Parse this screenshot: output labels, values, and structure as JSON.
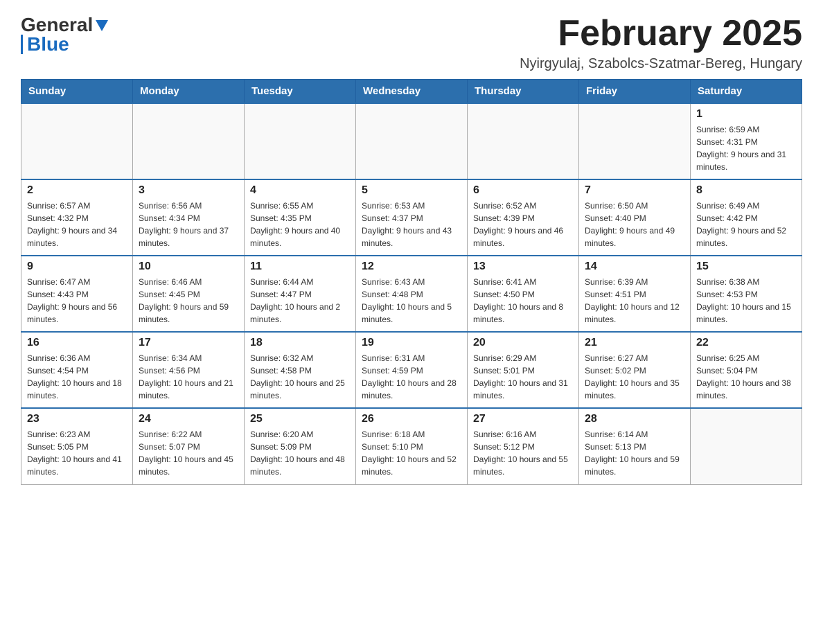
{
  "header": {
    "logo": {
      "general": "General",
      "blue": "Blue"
    },
    "title": "February 2025",
    "location": "Nyirgyulaj, Szabolcs-Szatmar-Bereg, Hungary"
  },
  "weekdays": [
    "Sunday",
    "Monday",
    "Tuesday",
    "Wednesday",
    "Thursday",
    "Friday",
    "Saturday"
  ],
  "weeks": [
    [
      {
        "day": "",
        "info": ""
      },
      {
        "day": "",
        "info": ""
      },
      {
        "day": "",
        "info": ""
      },
      {
        "day": "",
        "info": ""
      },
      {
        "day": "",
        "info": ""
      },
      {
        "day": "",
        "info": ""
      },
      {
        "day": "1",
        "info": "Sunrise: 6:59 AM\nSunset: 4:31 PM\nDaylight: 9 hours and 31 minutes."
      }
    ],
    [
      {
        "day": "2",
        "info": "Sunrise: 6:57 AM\nSunset: 4:32 PM\nDaylight: 9 hours and 34 minutes."
      },
      {
        "day": "3",
        "info": "Sunrise: 6:56 AM\nSunset: 4:34 PM\nDaylight: 9 hours and 37 minutes."
      },
      {
        "day": "4",
        "info": "Sunrise: 6:55 AM\nSunset: 4:35 PM\nDaylight: 9 hours and 40 minutes."
      },
      {
        "day": "5",
        "info": "Sunrise: 6:53 AM\nSunset: 4:37 PM\nDaylight: 9 hours and 43 minutes."
      },
      {
        "day": "6",
        "info": "Sunrise: 6:52 AM\nSunset: 4:39 PM\nDaylight: 9 hours and 46 minutes."
      },
      {
        "day": "7",
        "info": "Sunrise: 6:50 AM\nSunset: 4:40 PM\nDaylight: 9 hours and 49 minutes."
      },
      {
        "day": "8",
        "info": "Sunrise: 6:49 AM\nSunset: 4:42 PM\nDaylight: 9 hours and 52 minutes."
      }
    ],
    [
      {
        "day": "9",
        "info": "Sunrise: 6:47 AM\nSunset: 4:43 PM\nDaylight: 9 hours and 56 minutes."
      },
      {
        "day": "10",
        "info": "Sunrise: 6:46 AM\nSunset: 4:45 PM\nDaylight: 9 hours and 59 minutes."
      },
      {
        "day": "11",
        "info": "Sunrise: 6:44 AM\nSunset: 4:47 PM\nDaylight: 10 hours and 2 minutes."
      },
      {
        "day": "12",
        "info": "Sunrise: 6:43 AM\nSunset: 4:48 PM\nDaylight: 10 hours and 5 minutes."
      },
      {
        "day": "13",
        "info": "Sunrise: 6:41 AM\nSunset: 4:50 PM\nDaylight: 10 hours and 8 minutes."
      },
      {
        "day": "14",
        "info": "Sunrise: 6:39 AM\nSunset: 4:51 PM\nDaylight: 10 hours and 12 minutes."
      },
      {
        "day": "15",
        "info": "Sunrise: 6:38 AM\nSunset: 4:53 PM\nDaylight: 10 hours and 15 minutes."
      }
    ],
    [
      {
        "day": "16",
        "info": "Sunrise: 6:36 AM\nSunset: 4:54 PM\nDaylight: 10 hours and 18 minutes."
      },
      {
        "day": "17",
        "info": "Sunrise: 6:34 AM\nSunset: 4:56 PM\nDaylight: 10 hours and 21 minutes."
      },
      {
        "day": "18",
        "info": "Sunrise: 6:32 AM\nSunset: 4:58 PM\nDaylight: 10 hours and 25 minutes."
      },
      {
        "day": "19",
        "info": "Sunrise: 6:31 AM\nSunset: 4:59 PM\nDaylight: 10 hours and 28 minutes."
      },
      {
        "day": "20",
        "info": "Sunrise: 6:29 AM\nSunset: 5:01 PM\nDaylight: 10 hours and 31 minutes."
      },
      {
        "day": "21",
        "info": "Sunrise: 6:27 AM\nSunset: 5:02 PM\nDaylight: 10 hours and 35 minutes."
      },
      {
        "day": "22",
        "info": "Sunrise: 6:25 AM\nSunset: 5:04 PM\nDaylight: 10 hours and 38 minutes."
      }
    ],
    [
      {
        "day": "23",
        "info": "Sunrise: 6:23 AM\nSunset: 5:05 PM\nDaylight: 10 hours and 41 minutes."
      },
      {
        "day": "24",
        "info": "Sunrise: 6:22 AM\nSunset: 5:07 PM\nDaylight: 10 hours and 45 minutes."
      },
      {
        "day": "25",
        "info": "Sunrise: 6:20 AM\nSunset: 5:09 PM\nDaylight: 10 hours and 48 minutes."
      },
      {
        "day": "26",
        "info": "Sunrise: 6:18 AM\nSunset: 5:10 PM\nDaylight: 10 hours and 52 minutes."
      },
      {
        "day": "27",
        "info": "Sunrise: 6:16 AM\nSunset: 5:12 PM\nDaylight: 10 hours and 55 minutes."
      },
      {
        "day": "28",
        "info": "Sunrise: 6:14 AM\nSunset: 5:13 PM\nDaylight: 10 hours and 59 minutes."
      },
      {
        "day": "",
        "info": ""
      }
    ]
  ]
}
